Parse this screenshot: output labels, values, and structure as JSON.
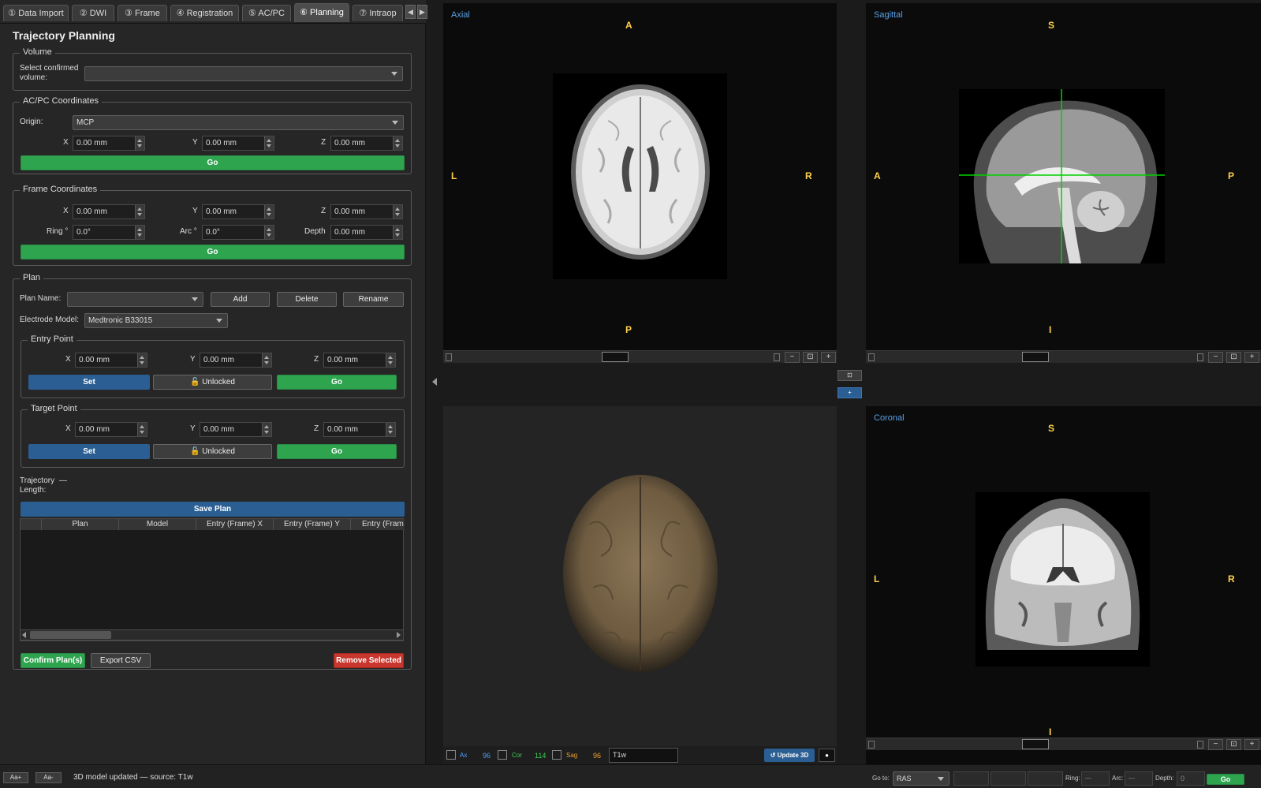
{
  "tabs": [
    "① Data Import",
    "② DWI",
    "③ Frame",
    "④ Registration",
    "⑤ AC/PC",
    "⑥ Planning",
    "⑦ Intraop"
  ],
  "tab_nav": {
    "prev": "◀",
    "next": "▶"
  },
  "panel_title": "Trajectory Planning",
  "volume": {
    "title": "Volume",
    "label": "Select confirmed volume:",
    "value": ""
  },
  "acpc": {
    "title": "AC/PC Coordinates",
    "origin_label": "Origin:",
    "origin_value": "MCP",
    "x_label": "X",
    "x": "0.00 mm",
    "y_label": "Y",
    "y": "0.00 mm",
    "z_label": "Z",
    "z": "0.00 mm",
    "go": "Go"
  },
  "frame": {
    "title": "Frame Coordinates",
    "x_label": "X",
    "x": "0.00 mm",
    "y_label": "Y",
    "y": "0.00 mm",
    "z_label": "Z",
    "z": "0.00 mm",
    "ring_label": "Ring °",
    "ring": "0.0°",
    "arc_label": "Arc °",
    "arc": "0.0°",
    "depth_label": "Depth",
    "depth": "0.00 mm",
    "go": "Go"
  },
  "plan": {
    "title": "Plan",
    "name_label": "Plan Name:",
    "name_value": "",
    "add": "Add",
    "delete": "Delete",
    "rename": "Rename",
    "model_label": "Electrode Model:",
    "model_value": "Medtronic B33015"
  },
  "entry": {
    "title": "Entry Point",
    "x_label": "X",
    "x": "0.00 mm",
    "y_label": "Y",
    "y": "0.00 mm",
    "z_label": "Z",
    "z": "0.00 mm",
    "set": "Set",
    "lock": "🔓 Unlocked",
    "go": "Go"
  },
  "target": {
    "title": "Target Point",
    "x_label": "X",
    "x": "0.00 mm",
    "y_label": "Y",
    "y": "0.00 mm",
    "z_label": "Z",
    "z": "0.00 mm",
    "set": "Set",
    "lock": "🔓 Unlocked",
    "go": "Go"
  },
  "trajectory": {
    "label": "Trajectory Length:",
    "value": "—"
  },
  "save_plan": "Save Plan",
  "table": {
    "columns": [
      "",
      "Plan",
      "Model",
      "Entry (Frame) X",
      "Entry (Frame) Y",
      "Entry (Fram"
    ]
  },
  "confirm": "Confirm Plan(s)",
  "export": "Export CSV",
  "remove": "Remove Selected",
  "views": {
    "axial": {
      "label": "Axial",
      "top": "A",
      "bottom": "P",
      "left": "L",
      "right": "R"
    },
    "sagittal": {
      "label": "Sagittal",
      "top": "S",
      "bottom": "I",
      "left": "A",
      "right": "P"
    },
    "coronal": {
      "label": "Coronal",
      "top": "S",
      "bottom": "I",
      "left": "L",
      "right": "R"
    }
  },
  "view_btns": {
    "minus": "−",
    "fit": "⊡",
    "plus": "+"
  },
  "center_btns": {
    "layout": "⊡",
    "add": "+"
  },
  "bottom3d": {
    "ax": "Ax",
    "ax_val": "96",
    "cor": "Cor",
    "cor_val": "114",
    "sag": "Sag",
    "sag_val": "96",
    "volume": "T1w",
    "update": "↺ Update 3D",
    "dot": "●"
  },
  "colors": {
    "ax": "#4da3ff",
    "cor": "#39d353",
    "sag": "#f0a030",
    "green": "#2ea44f",
    "blue": "#2b5f93",
    "red": "#c8362d",
    "orient": "#ffd24a"
  },
  "status": {
    "font_up": "Aa+",
    "font_down": "Aa-",
    "message": "3D model updated — source: T1w",
    "goto_label": "Go to:",
    "goto_value": "RAS",
    "ring_label": "Ring:",
    "ring": "—",
    "arc_label": "Arc:",
    "arc": "—",
    "depth_label": "Depth:",
    "depth": "0",
    "go": "Go"
  }
}
